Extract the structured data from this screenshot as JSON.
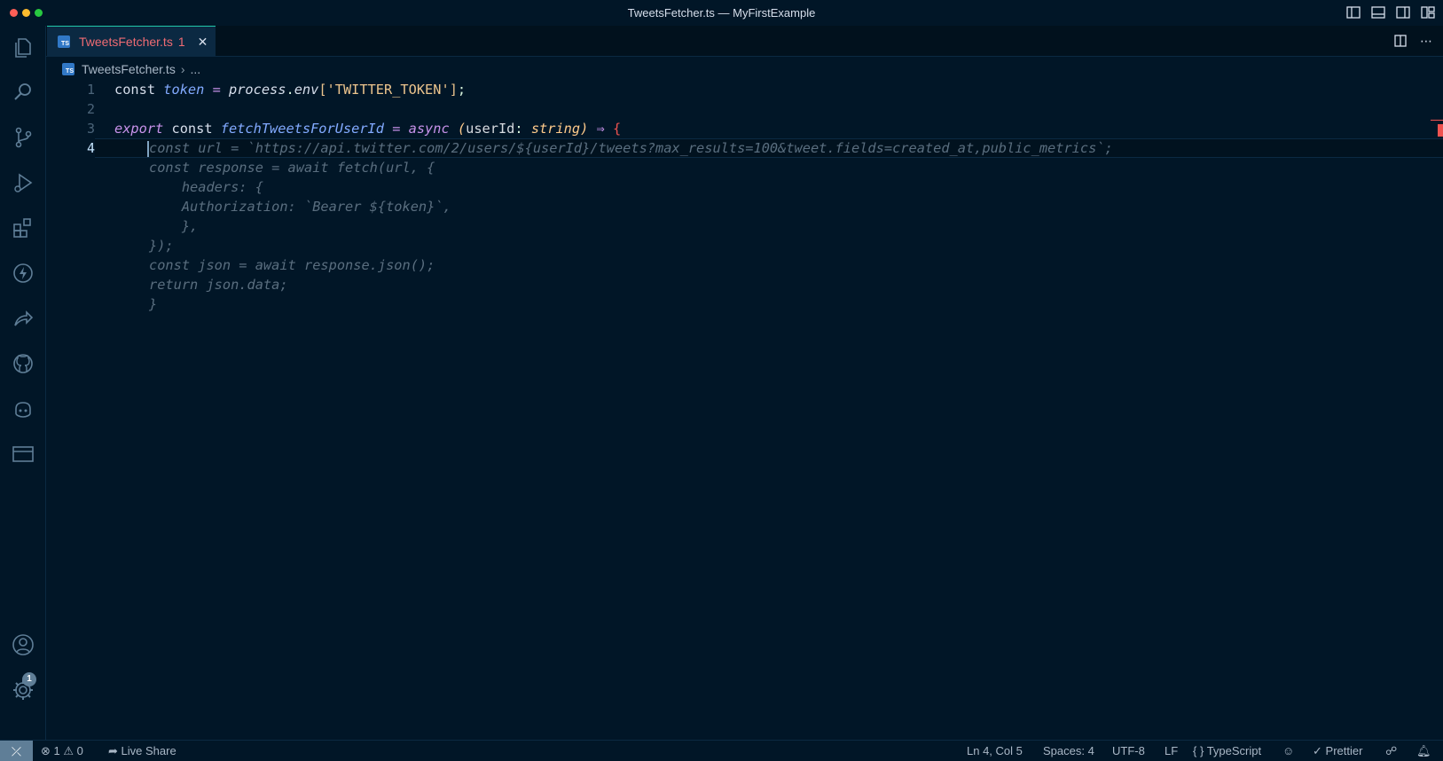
{
  "window": {
    "title": "TweetsFetcher.ts — MyFirstExample"
  },
  "tab": {
    "label": "TweetsFetcher.ts",
    "problem_count": "1",
    "icon_text": "TS"
  },
  "breadcrumb": {
    "file": "TweetsFetcher.ts",
    "more": "..."
  },
  "editor": {
    "line_numbers": [
      "1",
      "2",
      "3",
      "4"
    ],
    "ghost_lines": [
      "const url = `https://api.twitter.com/2/users/${userId}/tweets?max_results=100&tweet.fields=created_at,public_metrics`;",
      "const response = await fetch(url, {",
      "    headers: {",
      "    Authorization: `Bearer ${token}`,",
      "    },",
      "});",
      "const json = await response.json();",
      "return json.data;",
      "}"
    ]
  },
  "activity": {
    "accounts_badge": "1"
  },
  "status": {
    "errors": "1",
    "warnings": "0",
    "live_share": "Live Share",
    "position": "Ln 4, Col 5",
    "spaces": "Spaces: 4",
    "encoding": "UTF-8",
    "eol": "LF",
    "language": "TypeScript",
    "formatter": "Prettier"
  },
  "colors": {
    "background": "#011627",
    "accent": "#21c7a8",
    "error": "#ef5350"
  }
}
